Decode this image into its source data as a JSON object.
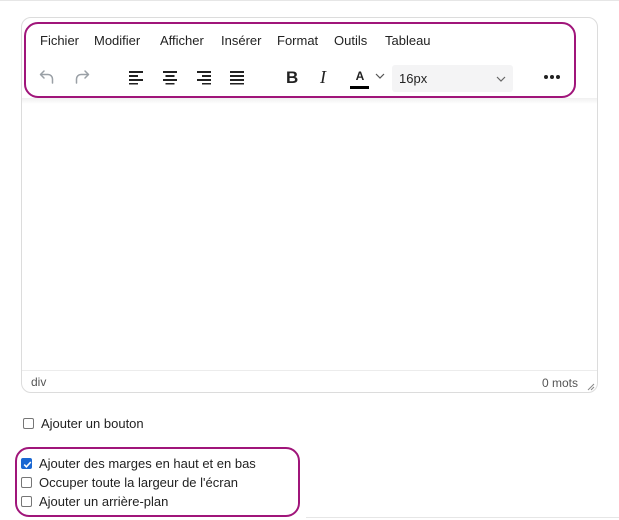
{
  "menu": {
    "items": [
      "Fichier",
      "Modifier",
      "Afficher",
      "Insérer",
      "Format",
      "Outils",
      "Tableau"
    ]
  },
  "toolbar": {
    "bold_label": "B",
    "italic_label": "I",
    "text_color_label": "A",
    "text_color": "#000000",
    "font_size_value": "16px"
  },
  "statusbar": {
    "path": "div",
    "word_count": "0 mots"
  },
  "options": {
    "add_button": {
      "label": "Ajouter un bouton",
      "checked": false
    },
    "margins": {
      "label": "Ajouter des marges en haut et en bas",
      "checked": true
    },
    "full_width": {
      "label": "Occuper toute la largeur de l'écran",
      "checked": false
    },
    "background": {
      "label": "Ajouter un arrière-plan",
      "checked": false
    }
  },
  "colors": {
    "highlight": "#a0157a",
    "checkbox_checked": "#1a67d2"
  }
}
